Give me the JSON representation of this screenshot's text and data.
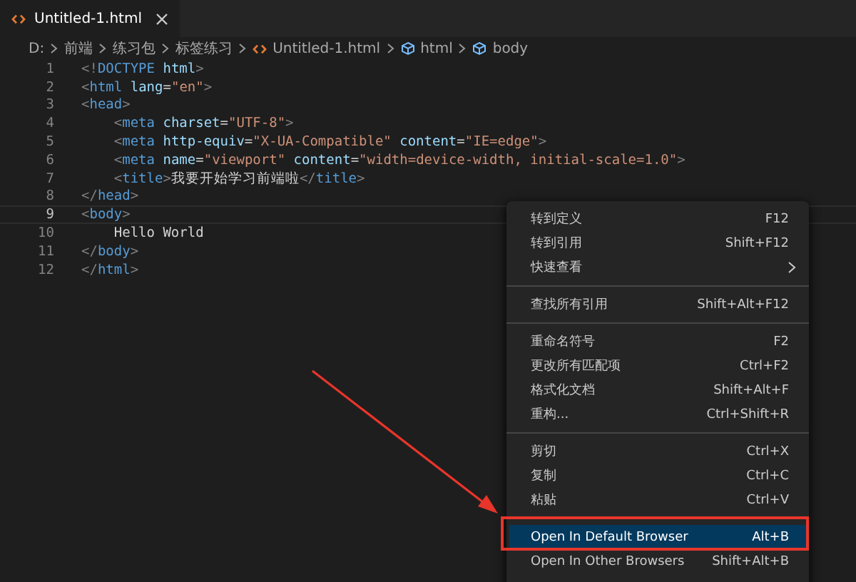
{
  "tabs": [
    {
      "label": "Untitled-1.html",
      "selected": true
    }
  ],
  "breadcrumb": [
    {
      "label": "D:",
      "kind": "folder"
    },
    {
      "label": "前端",
      "kind": "folder"
    },
    {
      "label": "练习包",
      "kind": "folder"
    },
    {
      "label": "标签练习",
      "kind": "folder"
    },
    {
      "label": "Untitled-1.html",
      "kind": "file"
    },
    {
      "label": "html",
      "kind": "symbol"
    },
    {
      "label": "body",
      "kind": "symbol"
    }
  ],
  "lines": [
    {
      "number": "1",
      "current": false,
      "tokens": [
        {
          "t": "<!",
          "kind": "punct"
        },
        {
          "t": "DOCTYPE",
          "kind": "tag"
        },
        {
          "t": " html",
          "kind": "attr"
        },
        {
          "t": ">",
          "kind": "punct"
        }
      ]
    },
    {
      "number": "2",
      "current": false,
      "tokens": [
        {
          "t": "<",
          "kind": "punct"
        },
        {
          "t": "html",
          "kind": "tag"
        },
        {
          "t": " lang",
          "kind": "attr"
        },
        {
          "t": "=",
          "kind": "text"
        },
        {
          "t": "\"en\"",
          "kind": "str"
        },
        {
          "t": ">",
          "kind": "punct"
        }
      ]
    },
    {
      "number": "3",
      "current": false,
      "tokens": [
        {
          "t": "<",
          "kind": "punct"
        },
        {
          "t": "head",
          "kind": "tag"
        },
        {
          "t": ">",
          "kind": "punct"
        }
      ]
    },
    {
      "number": "4",
      "current": false,
      "tokens": [
        {
          "t": "    <",
          "kind": "punct"
        },
        {
          "t": "meta",
          "kind": "tag"
        },
        {
          "t": " charset",
          "kind": "attr"
        },
        {
          "t": "=",
          "kind": "text"
        },
        {
          "t": "\"UTF-8\"",
          "kind": "str"
        },
        {
          "t": ">",
          "kind": "punct"
        }
      ]
    },
    {
      "number": "5",
      "current": false,
      "tokens": [
        {
          "t": "    <",
          "kind": "punct"
        },
        {
          "t": "meta",
          "kind": "tag"
        },
        {
          "t": " http-equiv",
          "kind": "attr"
        },
        {
          "t": "=",
          "kind": "text"
        },
        {
          "t": "\"X-UA-Compatible\"",
          "kind": "str"
        },
        {
          "t": " content",
          "kind": "attr"
        },
        {
          "t": "=",
          "kind": "text"
        },
        {
          "t": "\"IE=edge\"",
          "kind": "str"
        },
        {
          "t": ">",
          "kind": "punct"
        }
      ]
    },
    {
      "number": "6",
      "current": false,
      "tokens": [
        {
          "t": "    <",
          "kind": "punct"
        },
        {
          "t": "meta",
          "kind": "tag"
        },
        {
          "t": " name",
          "kind": "attr"
        },
        {
          "t": "=",
          "kind": "text"
        },
        {
          "t": "\"viewport\"",
          "kind": "str"
        },
        {
          "t": " content",
          "kind": "attr"
        },
        {
          "t": "=",
          "kind": "text"
        },
        {
          "t": "\"width=device-width, initial-scale=1.0\"",
          "kind": "str"
        },
        {
          "t": ">",
          "kind": "punct"
        }
      ]
    },
    {
      "number": "7",
      "current": false,
      "tokens": [
        {
          "t": "    <",
          "kind": "punct"
        },
        {
          "t": "title",
          "kind": "tag"
        },
        {
          "t": ">",
          "kind": "punct"
        },
        {
          "t": "我要开始学习前端啦",
          "kind": "text"
        },
        {
          "t": "</",
          "kind": "punct"
        },
        {
          "t": "title",
          "kind": "tag"
        },
        {
          "t": ">",
          "kind": "punct"
        }
      ]
    },
    {
      "number": "8",
      "current": false,
      "tokens": [
        {
          "t": "</",
          "kind": "punct"
        },
        {
          "t": "head",
          "kind": "tag"
        },
        {
          "t": ">",
          "kind": "punct"
        }
      ]
    },
    {
      "number": "9",
      "current": true,
      "tokens": [
        {
          "t": "<",
          "kind": "punct"
        },
        {
          "t": "body",
          "kind": "tag"
        },
        {
          "t": ">",
          "kind": "punct"
        }
      ]
    },
    {
      "number": "10",
      "current": false,
      "tokens": [
        {
          "t": "    Hello World",
          "kind": "text"
        }
      ]
    },
    {
      "number": "11",
      "current": false,
      "tokens": [
        {
          "t": "</",
          "kind": "punct"
        },
        {
          "t": "body",
          "kind": "tag"
        },
        {
          "t": ">",
          "kind": "punct"
        }
      ]
    },
    {
      "number": "12",
      "current": false,
      "tokens": [
        {
          "t": "</",
          "kind": "punct"
        },
        {
          "t": "html",
          "kind": "tag"
        },
        {
          "t": ">",
          "kind": "punct"
        }
      ]
    }
  ],
  "context_menu": [
    [
      {
        "label": "转到定义",
        "shortcut": "F12",
        "kind": "command",
        "selected": false
      },
      {
        "label": "转到引用",
        "shortcut": "Shift+F12",
        "kind": "command",
        "selected": false
      },
      {
        "label": "快速查看",
        "kind": "submenu",
        "selected": false
      }
    ],
    [
      {
        "label": "查找所有引用",
        "shortcut": "Shift+Alt+F12",
        "kind": "command",
        "selected": false
      }
    ],
    [
      {
        "label": "重命名符号",
        "shortcut": "F2",
        "kind": "command",
        "selected": false
      },
      {
        "label": "更改所有匹配项",
        "shortcut": "Ctrl+F2",
        "kind": "command",
        "selected": false
      },
      {
        "label": "格式化文档",
        "shortcut": "Shift+Alt+F",
        "kind": "command",
        "selected": false
      },
      {
        "label": "重构...",
        "shortcut": "Ctrl+Shift+R",
        "kind": "command",
        "selected": false
      }
    ],
    [
      {
        "label": "剪切",
        "shortcut": "Ctrl+X",
        "kind": "command",
        "selected": false
      },
      {
        "label": "复制",
        "shortcut": "Ctrl+C",
        "kind": "command",
        "selected": false
      },
      {
        "label": "粘贴",
        "shortcut": "Ctrl+V",
        "kind": "command",
        "selected": false
      }
    ],
    [
      {
        "label": "Open In Default Browser",
        "shortcut": "Alt+B",
        "kind": "command",
        "selected": true
      },
      {
        "label": "Open In Other Browsers",
        "shortcut": "Shift+Alt+B",
        "kind": "command",
        "selected": false
      }
    ]
  ]
}
